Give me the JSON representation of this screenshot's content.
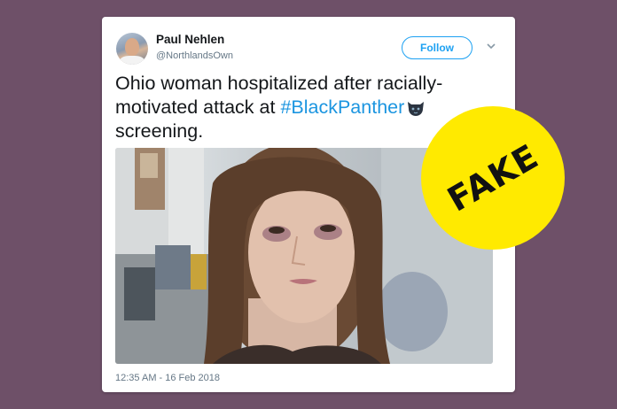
{
  "tweet": {
    "author": {
      "display_name": "Paul Nehlen",
      "handle": "@NorthlandsOwn"
    },
    "follow_label": "Follow",
    "text_lines": {
      "line1": "Ohio woman hospitalized after racially-",
      "line2_prefix": "motivated attack at ",
      "hashtag": "#BlackPanther",
      "line3": "screening."
    },
    "timestamp": "12:35 AM - 16 Feb 2018",
    "link_color": "#1b95e0"
  },
  "badge": {
    "label": "FAKE",
    "color": "#ffea00"
  },
  "icons": {
    "caret": "chevron-down-icon",
    "emoji": "black-panther-emoji-icon"
  }
}
